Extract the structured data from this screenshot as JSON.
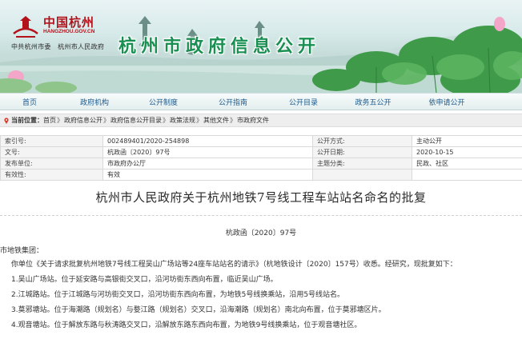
{
  "header": {
    "logo_cn": "中国杭州",
    "logo_url": "HANGZHOU.GOV.CN",
    "logo_sub": "中共杭州市委　杭州市人民政府",
    "site_title": "杭州市政府信息公开",
    "colors": {
      "title_green": "#1a8f52",
      "logo_red": "#b3121b",
      "nav_text": "#1c5a8c"
    }
  },
  "nav": {
    "items": [
      "首页",
      "政府机构",
      "公开制度",
      "公开指南",
      "公开目录",
      "政务五公开",
      "依申请公开"
    ]
  },
  "breadcrumb": {
    "label": "当前位置：",
    "items": [
      "首页",
      "政府信息公开",
      "政府信息公开目录",
      "政策法规",
      "其他文件",
      "市政府文件"
    ],
    "separator": "》"
  },
  "meta": {
    "rows": [
      [
        "索引号:",
        "002489401/2020-254898",
        "公开方式:",
        "主动公开"
      ],
      [
        "文号:",
        "杭政函〔2020〕97号",
        "公开日期:",
        "2020-10-15"
      ],
      [
        "发布单位:",
        "市政府办公厅",
        "主题分类:",
        "民政、社区"
      ],
      [
        "有效性:",
        "有效",
        "",
        ""
      ]
    ]
  },
  "article": {
    "title": "杭州市人民政府关于杭州地铁7号线工程车站站名命名的批复",
    "doc_no": "杭政函〔2020〕97号",
    "addressee": "市地铁集团：",
    "paragraphs": [
      "你单位《关于请求批复杭州地铁7号线工程吴山广场站等24座车站站名的请示》（杭地铁设计〔2020〕157号）收悉。经研究，现批复如下：",
      "1.吴山广场站。位于延安路与高银街交叉口，沿河坊街东西向布置，临近吴山广场。",
      "2.江城路站。位于江城路与河坊街交叉口，沿河坊街东西向布置，为地铁5号线换乘站，沿用5号线站名。",
      "3.莫邪塘站。位于海潮路（规划名）与婺江路（规划名）交叉口，沿海潮路（规划名）南北向布置，位于莫邪塘区片。",
      "4.观音塘站。位于解放东路与秋涛路交叉口，沿解放东路东西向布置，为地铁9号线换乘站，位于观音塘社区。"
    ]
  }
}
